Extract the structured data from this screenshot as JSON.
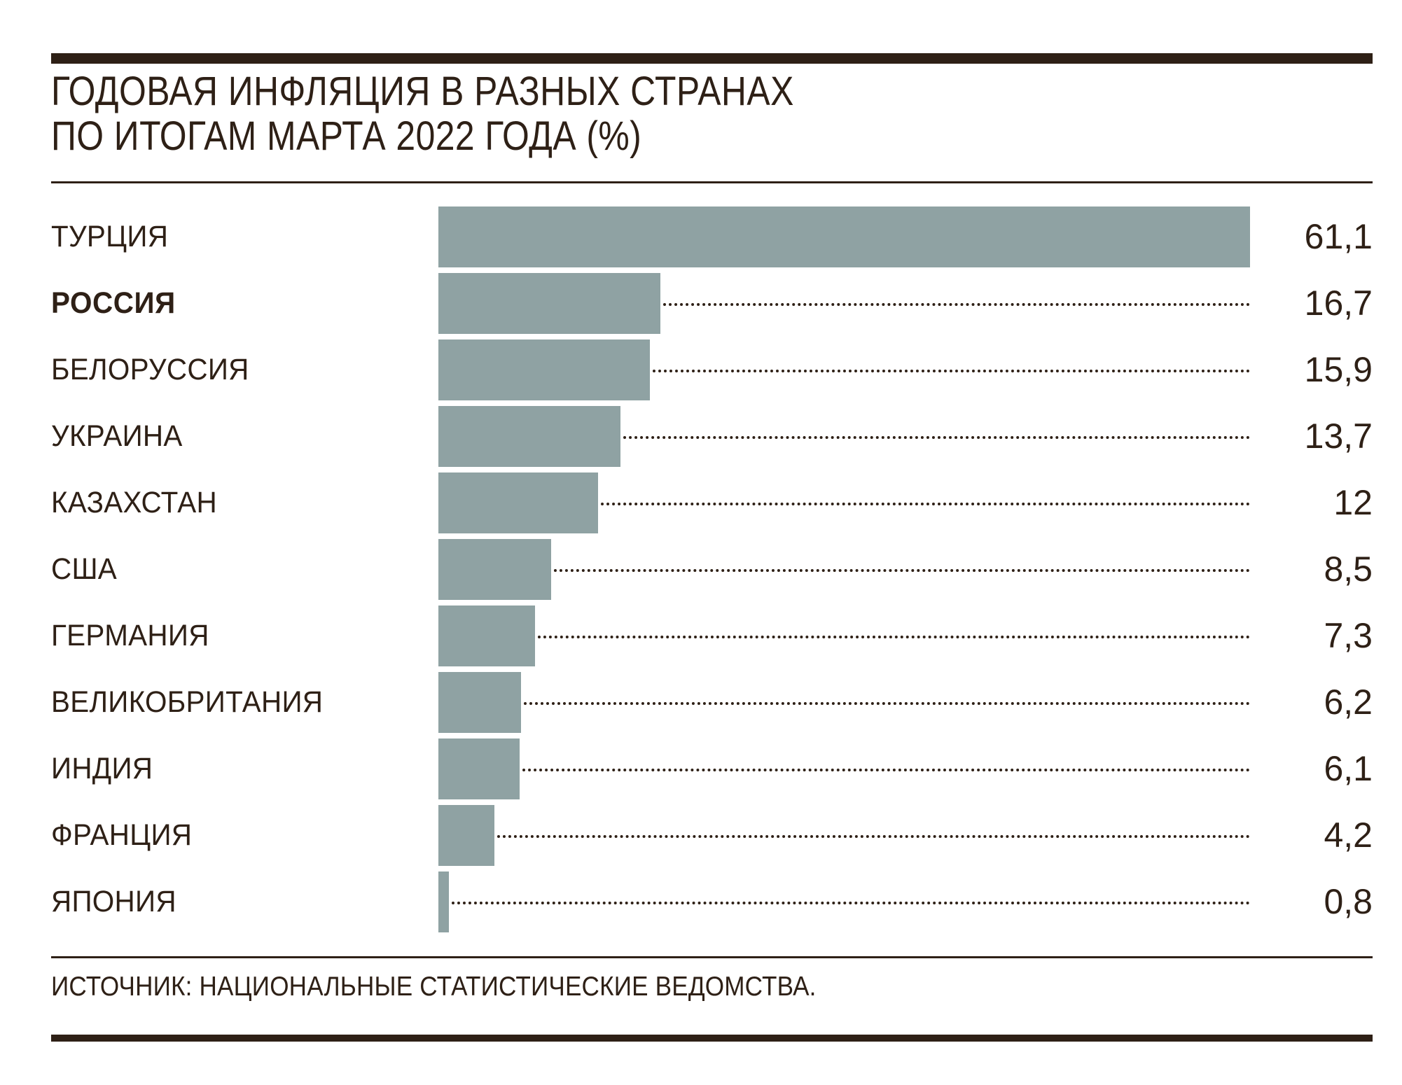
{
  "header": {
    "title_line1": "ГОДОВАЯ ИНФЛЯЦИЯ В РАЗНЫХ СТРАНАХ",
    "title_line2": "ПО ИТОГАМ МАРТА 2022 ГОДА (%)"
  },
  "footer": {
    "source": "ИСТОЧНИК: НАЦИОНАЛЬНЫЕ СТАТИСТИЧЕСКИЕ ВЕДОМСТВА."
  },
  "colors": {
    "ink": "#2E2016",
    "bar": "#8FA2A3",
    "background": "#FFFFFF"
  },
  "chart_data": {
    "type": "bar",
    "orientation": "horizontal",
    "title": "ГОДОВАЯ ИНФЛЯЦИЯ В РАЗНЫХ СТРАНАХ ПО ИТОГАМ МАРТА 2022 ГОДА (%)",
    "subtitle": "",
    "xlabel": "",
    "ylabel": "",
    "unit": "%",
    "grid": false,
    "legend": false,
    "xlim": [
      0,
      61.1
    ],
    "categories": [
      "ТУРЦИЯ",
      "РОССИЯ",
      "БЕЛОРУССИЯ",
      "УКРАИНА",
      "КАЗАХСТАН",
      "США",
      "ГЕРМАНИЯ",
      "ВЕЛИКОБРИТАНИЯ",
      "ИНДИЯ",
      "ФРАНЦИЯ",
      "ЯПОНИЯ"
    ],
    "values": [
      61.1,
      16.7,
      15.9,
      13.7,
      12,
      8.5,
      7.3,
      6.2,
      6.1,
      4.2,
      0.8
    ],
    "value_labels": [
      "61,1",
      "16,7",
      "15,9",
      "13,7",
      "12",
      "8,5",
      "7,3",
      "6,2",
      "6,1",
      "4,2",
      "0,8"
    ],
    "highlight": "РОССИЯ",
    "rows": [
      {
        "label": "ТУРЦИЯ",
        "value": 61.1,
        "value_label": "61,1",
        "highlight": false
      },
      {
        "label": "РОССИЯ",
        "value": 16.7,
        "value_label": "16,7",
        "highlight": true
      },
      {
        "label": "БЕЛОРУССИЯ",
        "value": 15.9,
        "value_label": "15,9",
        "highlight": false
      },
      {
        "label": "УКРАИНА",
        "value": 13.7,
        "value_label": "13,7",
        "highlight": false
      },
      {
        "label": "КАЗАХСТАН",
        "value": 12,
        "value_label": "12",
        "highlight": false
      },
      {
        "label": "США",
        "value": 8.5,
        "value_label": "8,5",
        "highlight": false
      },
      {
        "label": "ГЕРМАНИЯ",
        "value": 7.3,
        "value_label": "7,3",
        "highlight": false
      },
      {
        "label": "ВЕЛИКОБРИТАНИЯ",
        "value": 6.2,
        "value_label": "6,2",
        "highlight": false
      },
      {
        "label": "ИНДИЯ",
        "value": 6.1,
        "value_label": "6,1",
        "highlight": false
      },
      {
        "label": "ФРАНЦИЯ",
        "value": 4.2,
        "value_label": "4,2",
        "highlight": false
      },
      {
        "label": "ЯПОНИЯ",
        "value": 0.8,
        "value_label": "0,8",
        "highlight": false
      }
    ]
  }
}
